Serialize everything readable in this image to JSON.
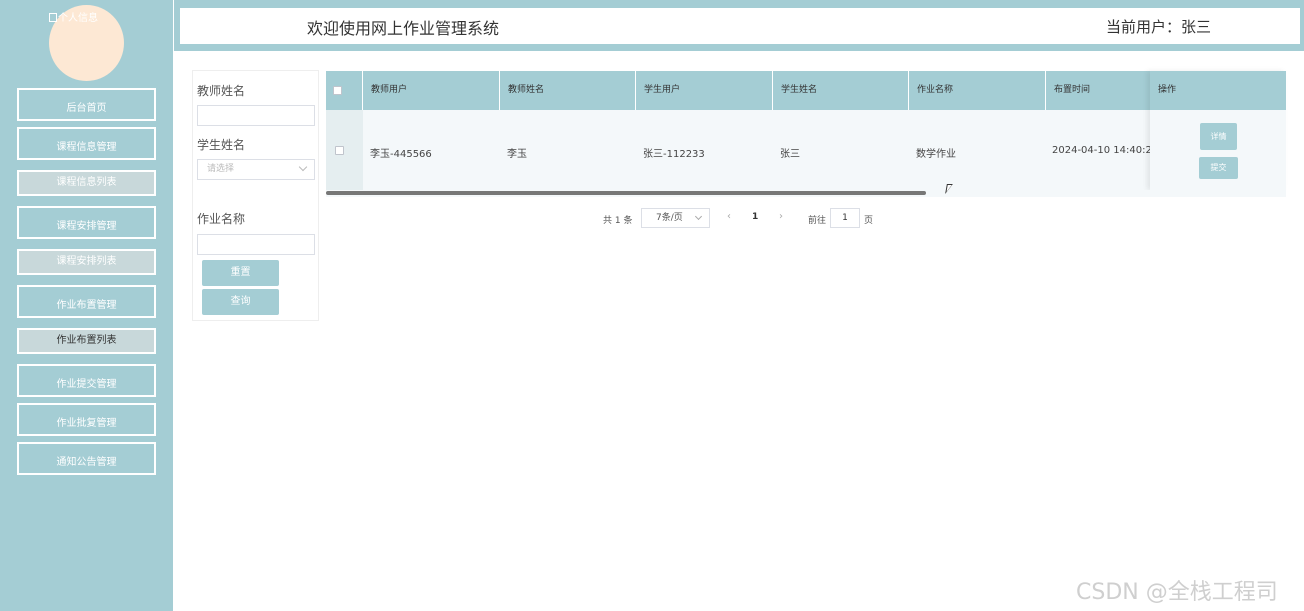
{
  "sidebar": {
    "avatar_alt": "个人信息",
    "items": [
      {
        "label": "后台首页"
      },
      {
        "label": "课程信息管理"
      },
      {
        "label": "课程信息列表"
      },
      {
        "label": "课程安排管理"
      },
      {
        "label": "课程安排列表"
      },
      {
        "label": "作业布置管理"
      },
      {
        "label": "作业布置列表"
      },
      {
        "label": "作业提交管理"
      },
      {
        "label": "作业批复管理"
      },
      {
        "label": "通知公告管理"
      }
    ]
  },
  "header": {
    "title": "欢迎使用网上作业管理系统",
    "current_user": "当前用户：张三"
  },
  "search": {
    "teacher_name_label": "教师姓名",
    "teacher_name_value": "",
    "student_name_label": "学生姓名",
    "student_name_placeholder": "请选择",
    "homework_name_label": "作业名称",
    "homework_name_value": "",
    "reset_label": "重置",
    "query_label": "查询"
  },
  "table": {
    "columns": [
      "教师用户",
      "教师姓名",
      "学生用户",
      "学生姓名",
      "作业名称",
      "布置时间",
      "操作"
    ],
    "rows": [
      {
        "teacher_user": "李玉-445566",
        "teacher_name": "李玉",
        "student_user": "张三-112233",
        "student_name": "张三",
        "homework_name": "数学作业",
        "assigned_time": "2024-04-10 14:40:2",
        "actions": [
          "详情",
          "提交"
        ]
      }
    ]
  },
  "pagination": {
    "total": "共 1 条",
    "page_size": "7条/页",
    "current_page": "1",
    "goto_label": "前往",
    "goto_value": "1",
    "page_suffix": "页"
  },
  "watermark": "CSDN @全栈工程司",
  "colors": {
    "accent": "#a4cdd4",
    "avatar_bg": "#fde8d4",
    "sub_item_bg": "#c8d8da"
  }
}
